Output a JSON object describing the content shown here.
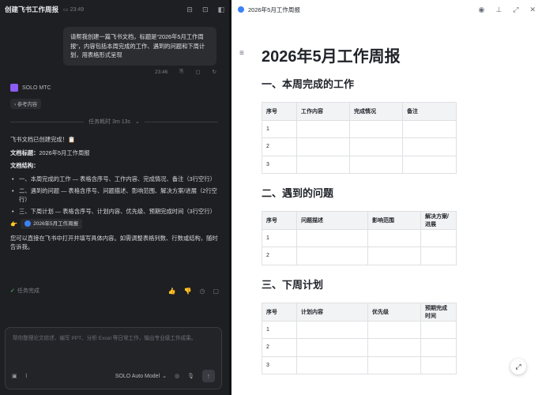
{
  "chat": {
    "title": "创建飞书工作周报",
    "timestamp": "23:49",
    "user_message": "请帮我创建一篇飞书文档，标题是“2026年5月工作周报”，内容包括本周完成的工作、遇到的问题和下周计划，用表格形式呈现",
    "user_message_time": "23:46",
    "agent_name": "SOLO MTC",
    "reference_chip": "参考内容",
    "elapsed": "任务耗时 3m 13s",
    "reply": {
      "intro": "飞书文档已创建完成！📋",
      "title_label": "文档标题：",
      "title_value": "2026年5月工作周报",
      "structure_label": "文档结构：",
      "bullets": [
        "一、本周完成的工作 — 表格含序号、工作内容、完成情况、备注（3行空行）",
        "二、遇到的问题 — 表格含序号、问题描述、影响范围、解决方案/进展（2行空行）",
        "三、下周计划 — 表格含序号、计划内容、优先级、预期完成时间（3行空行）"
      ],
      "doc_link": "2026年5月工作周报",
      "outro": "您可以直接在飞书中打开并填写具体内容。如需调整表格列数、行数或结构，随时告诉我。"
    },
    "status": "任务完成",
    "composer_placeholder": "帮你整理论文综述、编写 PPT、分析 Excel 等日常工作，输出专业级工作成果。",
    "model_label": "SOLO Auto Model"
  },
  "document": {
    "tab_title": "2026年5月工作周报",
    "title": "2026年5月工作周报",
    "sections": [
      {
        "heading": "一、本周完成的工作",
        "columns": [
          "序号",
          "工作内容",
          "完成情况",
          "备注"
        ],
        "rows": [
          [
            "1",
            "",
            "",
            ""
          ],
          [
            "2",
            "",
            "",
            ""
          ],
          [
            "3",
            "",
            "",
            ""
          ]
        ]
      },
      {
        "heading": "二、遇到的问题",
        "columns": [
          "序号",
          "问题描述",
          "影响范围",
          "解决方案/进展"
        ],
        "rows": [
          [
            "1",
            "",
            "",
            ""
          ],
          [
            "2",
            "",
            "",
            ""
          ]
        ]
      },
      {
        "heading": "三、下周计划",
        "columns": [
          "序号",
          "计划内容",
          "优先级",
          "预期完成时间"
        ],
        "rows": [
          [
            "1",
            "",
            "",
            ""
          ],
          [
            "2",
            "",
            "",
            ""
          ],
          [
            "3",
            "",
            "",
            ""
          ]
        ]
      }
    ]
  },
  "icons": {
    "history": "history-icon",
    "copy": "copy-icon",
    "refresh": "refresh-icon",
    "outline": "outline-icon",
    "fullscreen": "fullscreen-icon"
  },
  "colors": {
    "accent": "#8b5cf6",
    "success": "#4ade80",
    "lark_blue": "#3b82f6"
  }
}
